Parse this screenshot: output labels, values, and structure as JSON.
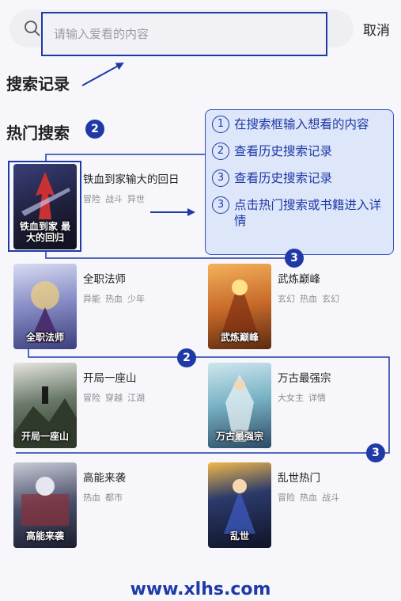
{
  "search": {
    "placeholder": "请输入爱看的内容",
    "cancel_label": "取消"
  },
  "history": {
    "title": "搜索记录"
  },
  "hot": {
    "title": "热门搜索"
  },
  "callout": {
    "lines": [
      {
        "num": "1",
        "text": "在搜索框输入想看的内容"
      },
      {
        "num": "2",
        "text": "查看历史搜索记录"
      },
      {
        "num": "3",
        "text": "查看历史搜索记录"
      },
      {
        "num": "3",
        "text": "点击热门搜索或书籍进入详情"
      }
    ]
  },
  "badges": {
    "hot": "2",
    "b1": "3",
    "b2": "2",
    "b3": "3"
  },
  "books": [
    {
      "title": "铁血到家输大的回日",
      "tags": [
        "冒险",
        "战斗",
        "异世"
      ],
      "cover_text": "铁血到家 最大的回归",
      "cover_color": "#1e1f3a"
    },
    {
      "title": "全职法师",
      "tags": [
        "异能",
        "热血",
        "少年"
      ],
      "cover_text": "全职法师",
      "cover_color": "#8a90c8"
    },
    {
      "title": "武炼巅峰",
      "tags": [
        "玄幻",
        "热血",
        "玄幻"
      ],
      "cover_text": "武炼巅峰",
      "cover_color": "#c86a2a"
    },
    {
      "title": "开局一座山",
      "tags": [
        "冒险",
        "穿越",
        "江湖"
      ],
      "cover_text": "开局一座山",
      "cover_color": "#3a4a3a"
    },
    {
      "title": "万古最强宗",
      "tags": [
        "大女主",
        "详情"
      ],
      "cover_text": "万古最强宗",
      "cover_color": "#7ab4c6"
    },
    {
      "title": "高能来袭",
      "tags": [
        "热血",
        "都市"
      ],
      "cover_text": "高能来袭",
      "cover_color": "#2a2f4a"
    },
    {
      "title": "乱世热门",
      "tags": [
        "冒险",
        "热血",
        "战斗"
      ],
      "cover_text": "乱世",
      "cover_color": "#2b3a6a"
    }
  ],
  "watermark": "www.xlhs.com",
  "colors": {
    "accent": "#1f3aa6",
    "background": "#f7f7fb"
  }
}
